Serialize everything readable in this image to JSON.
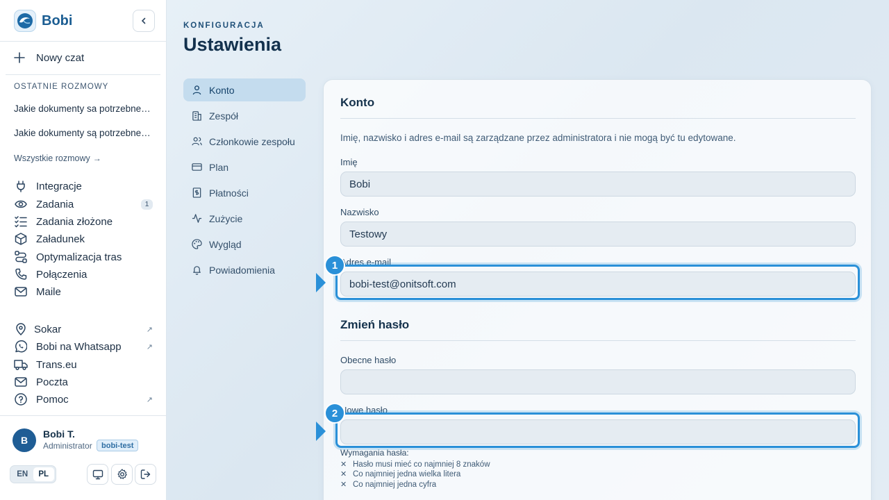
{
  "brand": {
    "name": "Bobi",
    "logo_icon": "dolphin-logo-icon"
  },
  "sidebar": {
    "new_chat": "Nowy czat",
    "recent_label": "OSTATNIE ROZMOWY",
    "recent": [
      "Jakie dokumenty sa potrzebne przy odprawie",
      "Jakie dokumenty są potrzebne przy odprawie"
    ],
    "all_chats": "Wszystkie rozmowy",
    "nav": [
      {
        "label": "Integracje",
        "icon": "plug-icon"
      },
      {
        "label": "Zadania",
        "icon": "eye-icon",
        "badge": "1"
      },
      {
        "label": "Zadania złożone",
        "icon": "checklist-icon"
      },
      {
        "label": "Załadunek",
        "icon": "box-icon"
      },
      {
        "label": "Optymalizacja tras",
        "icon": "route-icon"
      },
      {
        "label": "Połączenia",
        "icon": "phone-icon"
      },
      {
        "label": "Maile",
        "icon": "mail-icon"
      }
    ],
    "external": [
      {
        "label": "Sokar",
        "icon": "map-pin-icon",
        "external": true
      },
      {
        "label": "Bobi na Whatsapp",
        "icon": "whatsapp-icon",
        "external": true
      },
      {
        "label": "Trans.eu",
        "icon": "truck-icon",
        "external": false
      },
      {
        "label": "Poczta",
        "icon": "mail-icon",
        "external": false
      },
      {
        "label": "Pomoc",
        "icon": "help-icon",
        "external": true
      }
    ],
    "external_mark": "↗"
  },
  "user": {
    "initial": "B",
    "name": "Bobi T.",
    "role": "Administrator",
    "org": "bobi-test"
  },
  "lang": {
    "en": "EN",
    "pl": "PL",
    "active": "PL"
  },
  "page": {
    "eyebrow": "KONFIGURACJA",
    "title": "Ustawienia"
  },
  "settings_nav": [
    {
      "label": "Konto",
      "icon": "user-icon",
      "active": true
    },
    {
      "label": "Zespół",
      "icon": "building-icon"
    },
    {
      "label": "Członkowie zespołu",
      "icon": "users-icon"
    },
    {
      "label": "Plan",
      "icon": "card-icon"
    },
    {
      "label": "Płatności",
      "icon": "invoice-icon"
    },
    {
      "label": "Zużycie",
      "icon": "activity-icon"
    },
    {
      "label": "Wygląd",
      "icon": "palette-icon"
    },
    {
      "label": "Powiadomienia",
      "icon": "bell-icon"
    }
  ],
  "account": {
    "title": "Konto",
    "note": "Imię, nazwisko i adres e-mail są zarządzane przez administratora i nie mogą być tu edytowane.",
    "first_name_label": "Imię",
    "first_name": "Bobi",
    "last_name_label": "Nazwisko",
    "last_name": "Testowy",
    "email_label": "Adres e-mail",
    "email": "bobi-test@onitsoft.com"
  },
  "password": {
    "title": "Zmień hasło",
    "current_label": "Obecne hasło",
    "current_value": "",
    "new_label": "Nowe hasło",
    "new_value": "",
    "requirements_title": "Wymagania hasła:",
    "requirements": [
      "Hasło musi mieć co najmniej 8 znaków",
      "Co najmniej jedna wielka litera",
      "Co najmniej jedna cyfra"
    ]
  },
  "annotations": [
    "1",
    "2"
  ],
  "colors": {
    "accent": "#2a90d8",
    "brand": "#1b5d92",
    "active_nav": "#c4dcee"
  }
}
